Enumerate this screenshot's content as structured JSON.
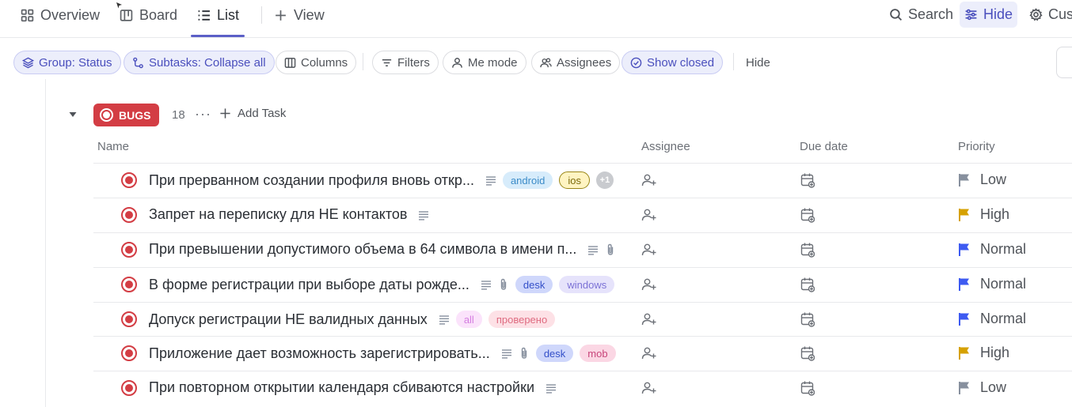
{
  "views": {
    "tabs": [
      {
        "label": "Overview",
        "icon": "overview-icon"
      },
      {
        "label": "Board",
        "icon": "board-icon"
      },
      {
        "label": "List",
        "icon": "list-icon",
        "active": true
      }
    ],
    "add_view_label": "View",
    "search_label": "Search",
    "hide_label": "Hide",
    "customize_label": "Cus"
  },
  "filters": {
    "group_label": "Group: Status",
    "subtasks_label": "Subtasks: Collapse all",
    "columns_label": "Columns",
    "filters_label": "Filters",
    "me_mode_label": "Me mode",
    "assignees_label": "Assignees",
    "show_closed_label": "Show closed",
    "hide_label": "Hide"
  },
  "group": {
    "status": "BUGS",
    "status_color": "#d33d44",
    "count": "18",
    "add_task_label": "Add Task"
  },
  "columns": {
    "name": "Name",
    "assignee": "Assignee",
    "due_date": "Due date",
    "priority": "Priority"
  },
  "tasks": [
    {
      "name": "При прерванном создании профиля вновь откр...",
      "attachment": false,
      "tags": [
        "android",
        "ios",
        "+1"
      ],
      "priority": "Low",
      "priority_color": "#87909e"
    },
    {
      "name": "Запрет на переписку для НЕ контактов",
      "attachment": false,
      "tags": [],
      "priority": "High",
      "priority_color": "#d6a100"
    },
    {
      "name": "При превышении допустимого объема в 64 символа в имени п...",
      "attachment": true,
      "tags": [],
      "priority": "Normal",
      "priority_color": "#3d5af1"
    },
    {
      "name": "В форме регистрации при выборе даты рожде...",
      "attachment": true,
      "tags": [
        "desk",
        "windows"
      ],
      "priority": "Normal",
      "priority_color": "#3d5af1"
    },
    {
      "name": "Допуск регистрации НЕ валидных данных",
      "attachment": false,
      "tags": [
        "all",
        "проверено"
      ],
      "priority": "Normal",
      "priority_color": "#3d5af1"
    },
    {
      "name": "Приложение дает возможность зарегистрировать...",
      "attachment": true,
      "tags": [
        "desk",
        "mob"
      ],
      "priority": "High",
      "priority_color": "#d6a100"
    },
    {
      "name": "При повторном открытии календаря сбиваются настройки",
      "attachment": false,
      "tags": [],
      "priority": "Low",
      "priority_color": "#87909e"
    }
  ],
  "colors": {
    "accent": "#5b5fc7",
    "bug_red": "#d33d44"
  }
}
